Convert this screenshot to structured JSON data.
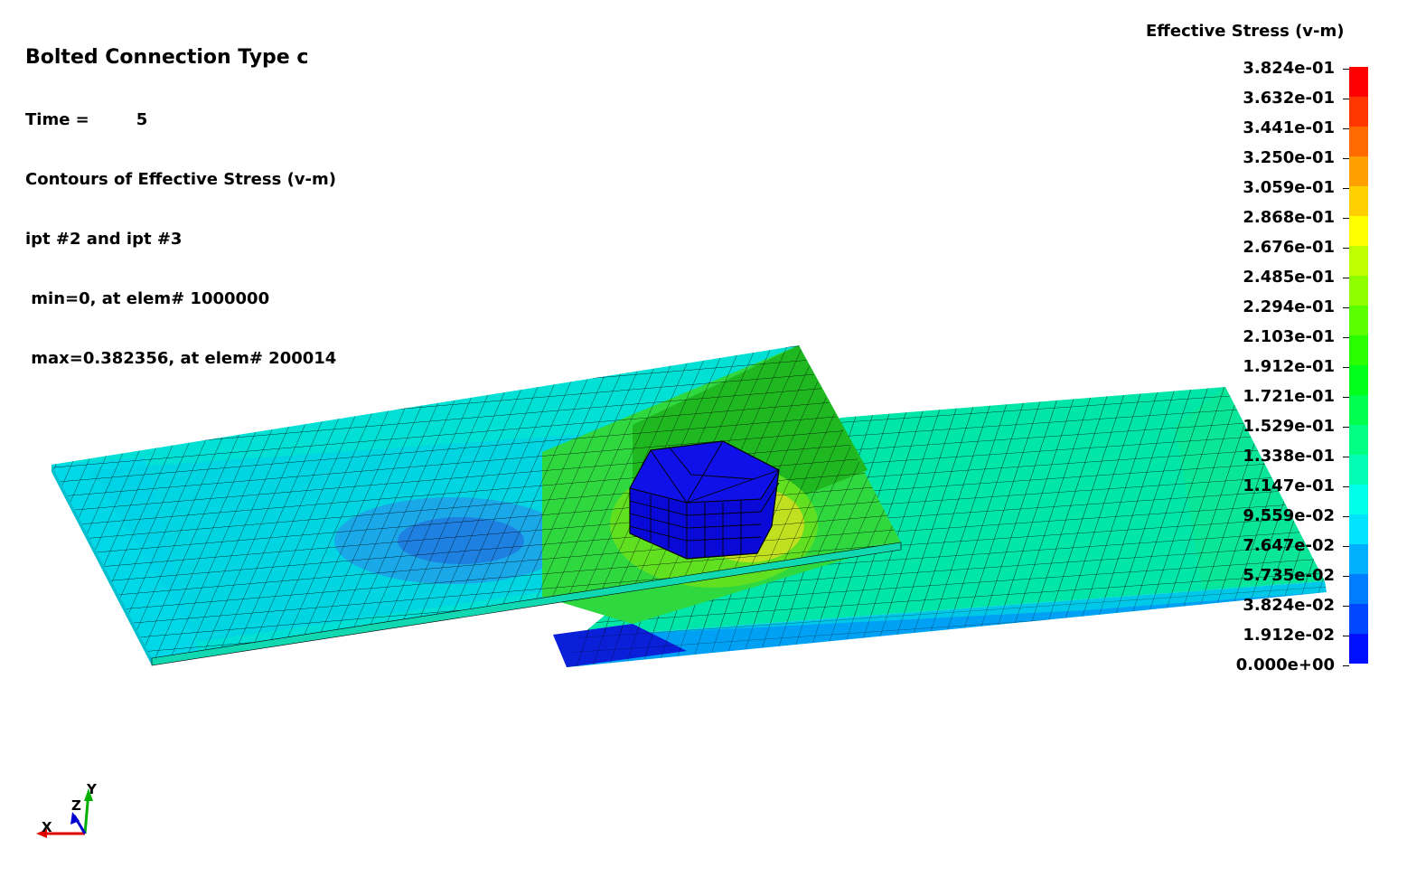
{
  "header": {
    "title": "Bolted Connection Type c",
    "time_label": "Time =",
    "time_value": "5",
    "contour_label": "Contours of Effective Stress (v-m)",
    "ipt_label": "ipt #2 and ipt #3",
    "min_label": " min=0, at elem# 1000000",
    "max_label": " max=0.382356, at elem# 200014"
  },
  "legend": {
    "title": "Effective Stress (v-m)",
    "ticks": [
      "3.824e-01",
      "3.632e-01",
      "3.441e-01",
      "3.250e-01",
      "3.059e-01",
      "2.868e-01",
      "2.676e-01",
      "2.485e-01",
      "2.294e-01",
      "2.103e-01",
      "1.912e-01",
      "1.721e-01",
      "1.529e-01",
      "1.338e-01",
      "1.147e-01",
      "9.559e-02",
      "7.647e-02",
      "5.735e-02",
      "3.824e-02",
      "1.912e-02",
      "0.000e+00"
    ],
    "colors": [
      "#ff0000",
      "#ff3600",
      "#ff6a00",
      "#ff9f00",
      "#ffcf00",
      "#ffff00",
      "#c0ff00",
      "#8fff00",
      "#5cff00",
      "#2aff00",
      "#00ff1a",
      "#00ff4e",
      "#00ff82",
      "#00ffb5",
      "#00ffe8",
      "#00e4ff",
      "#00b0ff",
      "#007cff",
      "#0048ff",
      "#0010ff"
    ]
  },
  "axes": {
    "x_label": "X",
    "y_label": "Y",
    "z_label": "Z",
    "x_color": "#e00000",
    "y_color": "#00b000",
    "z_color": "#0000d0"
  }
}
